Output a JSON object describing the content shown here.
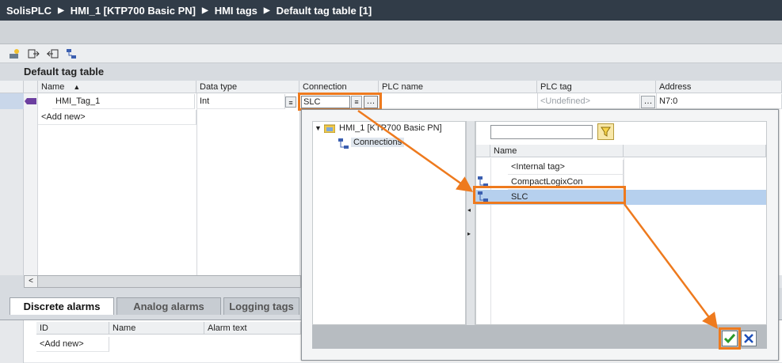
{
  "breadcrumb": [
    "SolisPLC",
    "HMI_1 [KTP700 Basic PN]",
    "HMI tags",
    "Default tag table [1]"
  ],
  "breadcrumb_sep": "▶",
  "table_title": "Default tag table",
  "columns": {
    "name": "Name",
    "data_type": "Data type",
    "connection": "Connection",
    "plc_name": "PLC name",
    "plc_tag": "PLC tag",
    "address": "Address"
  },
  "row1": {
    "name": "HMI_Tag_1",
    "data_type": "Int",
    "connection": "SLC",
    "plc_tag": "<Undefined>",
    "address": "N7:0"
  },
  "add_new": "<Add new>",
  "tabs": [
    "Discrete alarms",
    "Analog alarms",
    "Logging tags"
  ],
  "alarm_columns": {
    "id": "ID",
    "name": "Name",
    "alarm_text": "Alarm text"
  },
  "popup": {
    "tree_root": "HMI_1 [KTP700 Basic PN]",
    "tree_child": "Connections",
    "list_header": "Name",
    "items": [
      "<Internal tag>",
      "CompactLogixCon",
      "SLC"
    ]
  },
  "colors": {
    "accent": "#ee7a1e",
    "selection": "#b6d0ee"
  }
}
